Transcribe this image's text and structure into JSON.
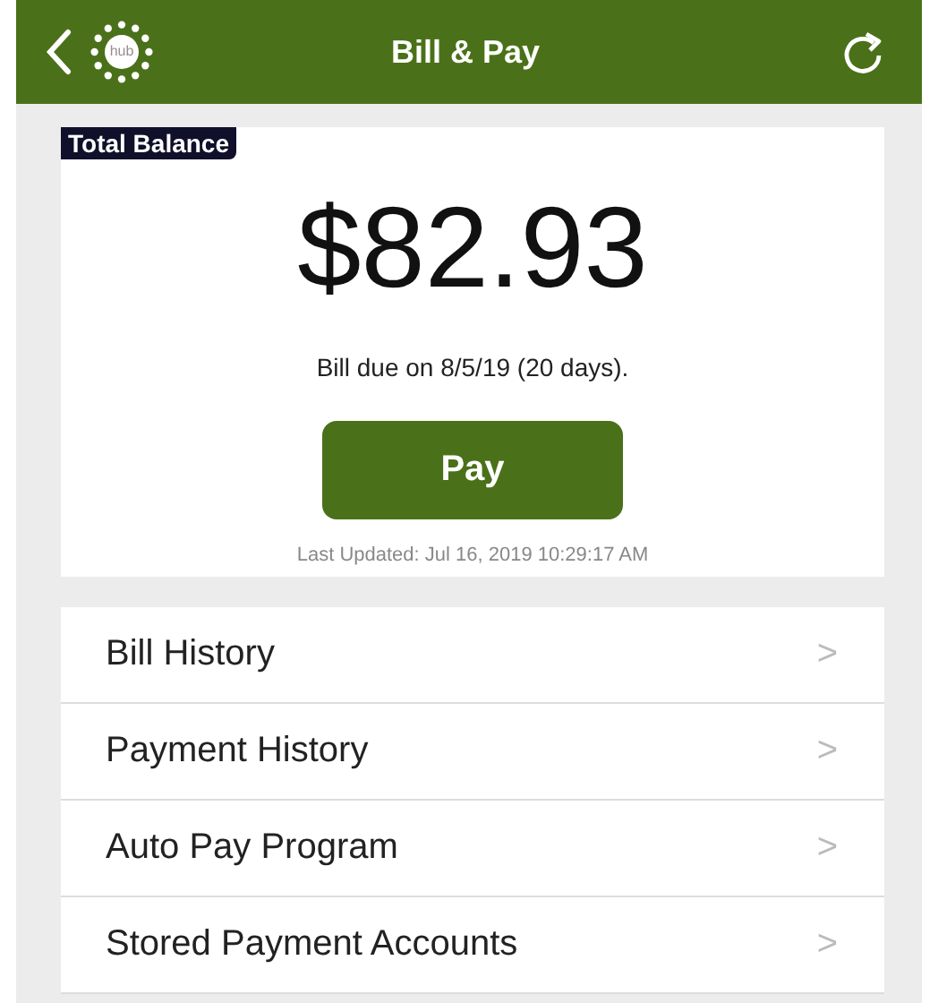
{
  "header": {
    "title": "Bill & Pay",
    "logo_text": "hub"
  },
  "balance": {
    "badge": "Total Balance",
    "amount": "$82.93",
    "due": "Bill due on 8/5/19 (20 days).",
    "button": "Pay",
    "updated": "Last Updated: Jul 16, 2019 10:29:17 AM"
  },
  "menu": [
    {
      "label": "Bill History",
      "chevron": ">"
    },
    {
      "label": "Payment History",
      "chevron": ">"
    },
    {
      "label": "Auto Pay Program",
      "chevron": ">"
    },
    {
      "label": "Stored Payment Accounts",
      "chevron": ">"
    }
  ]
}
